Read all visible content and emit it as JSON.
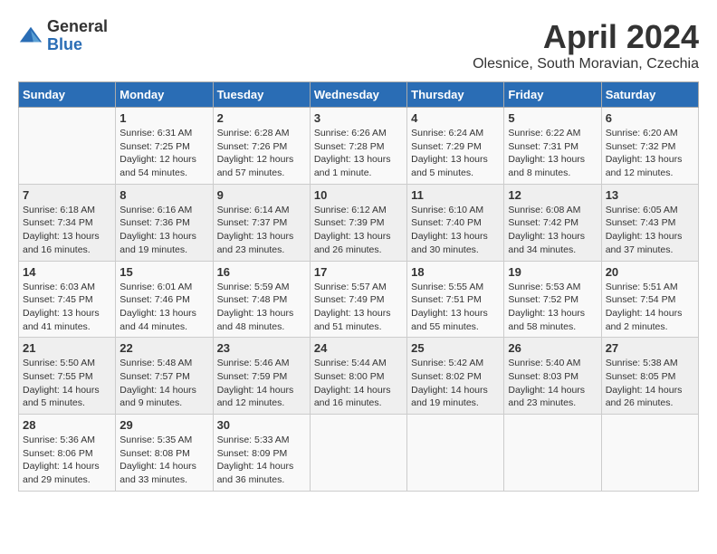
{
  "logo": {
    "general": "General",
    "blue": "Blue"
  },
  "title": {
    "month": "April 2024",
    "location": "Olesnice, South Moravian, Czechia"
  },
  "header_days": [
    "Sunday",
    "Monday",
    "Tuesday",
    "Wednesday",
    "Thursday",
    "Friday",
    "Saturday"
  ],
  "weeks": [
    [
      {
        "day": "",
        "info": ""
      },
      {
        "day": "1",
        "info": "Sunrise: 6:31 AM\nSunset: 7:25 PM\nDaylight: 12 hours\nand 54 minutes."
      },
      {
        "day": "2",
        "info": "Sunrise: 6:28 AM\nSunset: 7:26 PM\nDaylight: 12 hours\nand 57 minutes."
      },
      {
        "day": "3",
        "info": "Sunrise: 6:26 AM\nSunset: 7:28 PM\nDaylight: 13 hours\nand 1 minute."
      },
      {
        "day": "4",
        "info": "Sunrise: 6:24 AM\nSunset: 7:29 PM\nDaylight: 13 hours\nand 5 minutes."
      },
      {
        "day": "5",
        "info": "Sunrise: 6:22 AM\nSunset: 7:31 PM\nDaylight: 13 hours\nand 8 minutes."
      },
      {
        "day": "6",
        "info": "Sunrise: 6:20 AM\nSunset: 7:32 PM\nDaylight: 13 hours\nand 12 minutes."
      }
    ],
    [
      {
        "day": "7",
        "info": "Sunrise: 6:18 AM\nSunset: 7:34 PM\nDaylight: 13 hours\nand 16 minutes."
      },
      {
        "day": "8",
        "info": "Sunrise: 6:16 AM\nSunset: 7:36 PM\nDaylight: 13 hours\nand 19 minutes."
      },
      {
        "day": "9",
        "info": "Sunrise: 6:14 AM\nSunset: 7:37 PM\nDaylight: 13 hours\nand 23 minutes."
      },
      {
        "day": "10",
        "info": "Sunrise: 6:12 AM\nSunset: 7:39 PM\nDaylight: 13 hours\nand 26 minutes."
      },
      {
        "day": "11",
        "info": "Sunrise: 6:10 AM\nSunset: 7:40 PM\nDaylight: 13 hours\nand 30 minutes."
      },
      {
        "day": "12",
        "info": "Sunrise: 6:08 AM\nSunset: 7:42 PM\nDaylight: 13 hours\nand 34 minutes."
      },
      {
        "day": "13",
        "info": "Sunrise: 6:05 AM\nSunset: 7:43 PM\nDaylight: 13 hours\nand 37 minutes."
      }
    ],
    [
      {
        "day": "14",
        "info": "Sunrise: 6:03 AM\nSunset: 7:45 PM\nDaylight: 13 hours\nand 41 minutes."
      },
      {
        "day": "15",
        "info": "Sunrise: 6:01 AM\nSunset: 7:46 PM\nDaylight: 13 hours\nand 44 minutes."
      },
      {
        "day": "16",
        "info": "Sunrise: 5:59 AM\nSunset: 7:48 PM\nDaylight: 13 hours\nand 48 minutes."
      },
      {
        "day": "17",
        "info": "Sunrise: 5:57 AM\nSunset: 7:49 PM\nDaylight: 13 hours\nand 51 minutes."
      },
      {
        "day": "18",
        "info": "Sunrise: 5:55 AM\nSunset: 7:51 PM\nDaylight: 13 hours\nand 55 minutes."
      },
      {
        "day": "19",
        "info": "Sunrise: 5:53 AM\nSunset: 7:52 PM\nDaylight: 13 hours\nand 58 minutes."
      },
      {
        "day": "20",
        "info": "Sunrise: 5:51 AM\nSunset: 7:54 PM\nDaylight: 14 hours\nand 2 minutes."
      }
    ],
    [
      {
        "day": "21",
        "info": "Sunrise: 5:50 AM\nSunset: 7:55 PM\nDaylight: 14 hours\nand 5 minutes."
      },
      {
        "day": "22",
        "info": "Sunrise: 5:48 AM\nSunset: 7:57 PM\nDaylight: 14 hours\nand 9 minutes."
      },
      {
        "day": "23",
        "info": "Sunrise: 5:46 AM\nSunset: 7:59 PM\nDaylight: 14 hours\nand 12 minutes."
      },
      {
        "day": "24",
        "info": "Sunrise: 5:44 AM\nSunset: 8:00 PM\nDaylight: 14 hours\nand 16 minutes."
      },
      {
        "day": "25",
        "info": "Sunrise: 5:42 AM\nSunset: 8:02 PM\nDaylight: 14 hours\nand 19 minutes."
      },
      {
        "day": "26",
        "info": "Sunrise: 5:40 AM\nSunset: 8:03 PM\nDaylight: 14 hours\nand 23 minutes."
      },
      {
        "day": "27",
        "info": "Sunrise: 5:38 AM\nSunset: 8:05 PM\nDaylight: 14 hours\nand 26 minutes."
      }
    ],
    [
      {
        "day": "28",
        "info": "Sunrise: 5:36 AM\nSunset: 8:06 PM\nDaylight: 14 hours\nand 29 minutes."
      },
      {
        "day": "29",
        "info": "Sunrise: 5:35 AM\nSunset: 8:08 PM\nDaylight: 14 hours\nand 33 minutes."
      },
      {
        "day": "30",
        "info": "Sunrise: 5:33 AM\nSunset: 8:09 PM\nDaylight: 14 hours\nand 36 minutes."
      },
      {
        "day": "",
        "info": ""
      },
      {
        "day": "",
        "info": ""
      },
      {
        "day": "",
        "info": ""
      },
      {
        "day": "",
        "info": ""
      }
    ]
  ]
}
